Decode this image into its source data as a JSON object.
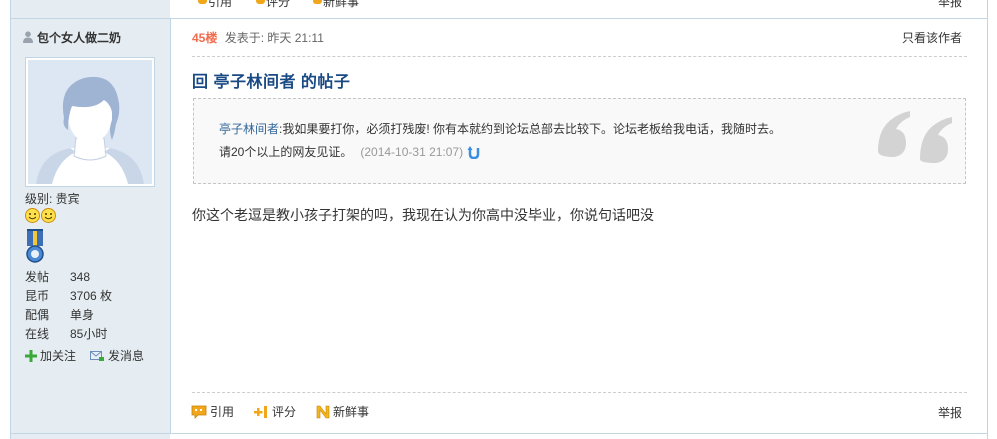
{
  "prev_post": {
    "cut_labels": [
      "引用",
      "评分",
      "新鲜事",
      "举报"
    ]
  },
  "author": {
    "username": "包个女人做二奶",
    "level": "级别: 贵宾",
    "stats": [
      {
        "label": "发帖",
        "value": "348"
      },
      {
        "label": "昆币",
        "value": "3706 枚"
      },
      {
        "label": "配偶",
        "value": "单身"
      },
      {
        "label": "在线",
        "value": "85小时"
      }
    ],
    "actions": {
      "follow": "加关注",
      "message": "发消息"
    }
  },
  "post": {
    "floor": "45楼",
    "posted_label": "发表于:",
    "posted_time": "昨天 21:11",
    "only_author": "只看该作者",
    "reply_title": "回 亭子林间者 的帖子",
    "quote": {
      "author": "亭子林间者",
      "line1_text": ":我如果要打你，必须打残废! 你有本就约到论坛总部去比较下。论坛老板给我电话，我随时去。",
      "line2_text": "请20个以上的网友见证。",
      "time": "(2014-10-31 21:07)"
    },
    "body": "你这个老逗是教小孩子打架的吗，我现在认为你高中没毕业，你说句话吧没"
  },
  "footer": {
    "quote_btn": "引用",
    "rate_btn": "评分",
    "news_btn": "新鲜事",
    "report_btn": "举报"
  },
  "colors": {
    "sidebar_bg": "#e5edf2",
    "border": "#c2d5e3",
    "floor": "#f26c4f",
    "title": "#1a4a84",
    "link": "#336699"
  }
}
